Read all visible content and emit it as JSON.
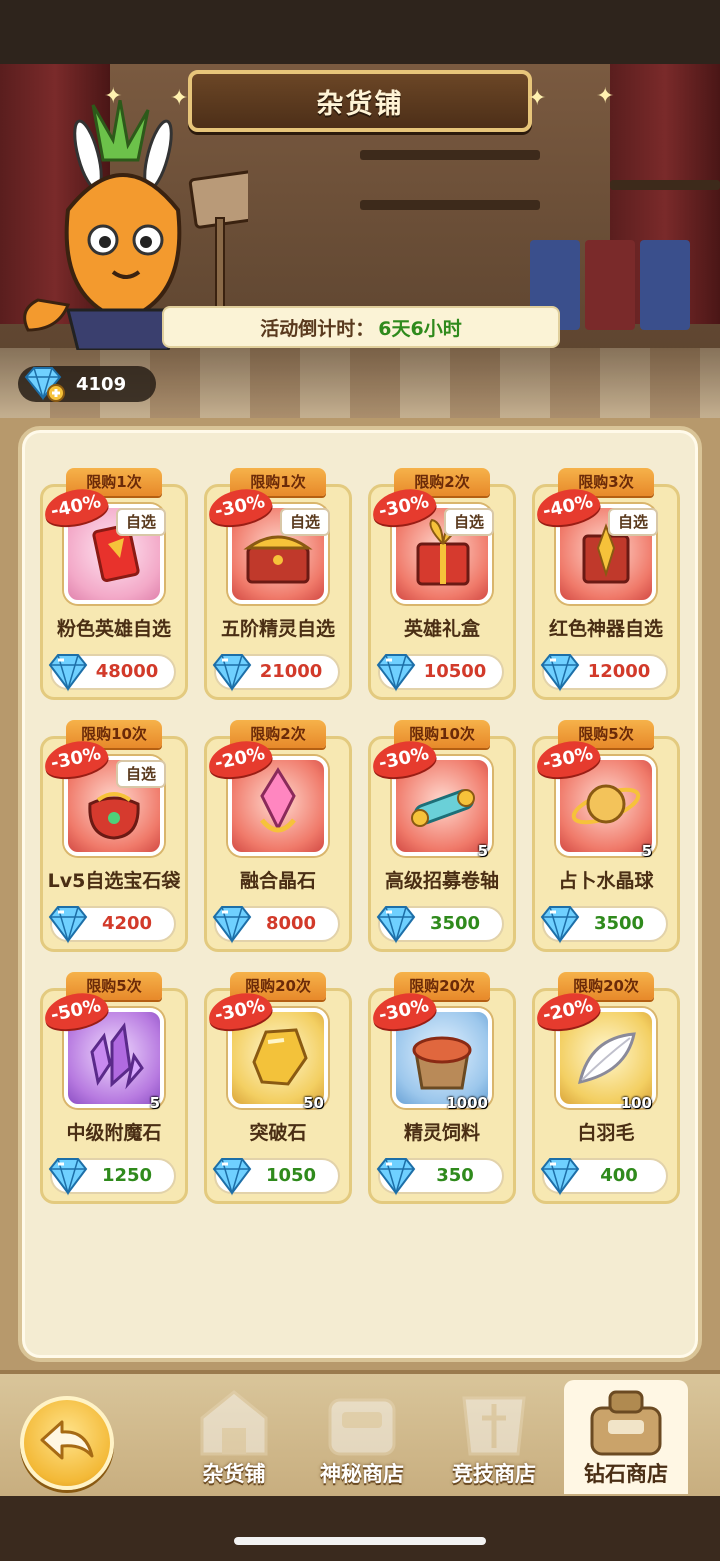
{
  "shop": {
    "title": "杂货铺",
    "countdown_label": "活动倒计时：",
    "countdown_value": "6天6小时",
    "currency_amount": "4109"
  },
  "items": [
    {
      "limit": "限购1次",
      "discount": "-40%",
      "choice": "自选",
      "name": "粉色英雄自选",
      "price": "48000",
      "price_color": "#d23a2a",
      "box": "pink",
      "icon": "pink-hero-card-icon"
    },
    {
      "limit": "限购1次",
      "discount": "-30%",
      "choice": "自选",
      "name": "五阶精灵自选",
      "price": "21000",
      "price_color": "#d23a2a",
      "box": "red",
      "icon": "treasure-chest-icon"
    },
    {
      "limit": "限购2次",
      "discount": "-30%",
      "choice": "自选",
      "name": "英雄礼盒",
      "price": "10500",
      "price_color": "#d23a2a",
      "box": "red",
      "icon": "hero-gift-box-icon"
    },
    {
      "limit": "限购3次",
      "discount": "-40%",
      "choice": "自选",
      "name": "红色神器自选",
      "price": "12000",
      "price_color": "#d23a2a",
      "box": "red",
      "icon": "red-artifact-icon"
    },
    {
      "limit": "限购10次",
      "discount": "-30%",
      "choice": "自选",
      "name": "Lv5自选宝石袋",
      "price": "4200",
      "price_color": "#d23a2a",
      "box": "red",
      "icon": "gem-pouch-icon"
    },
    {
      "limit": "限购2次",
      "discount": "-20%",
      "choice": "",
      "name": "融合晶石",
      "price": "8000",
      "price_color": "#d23a2a",
      "box": "red",
      "icon": "fusion-crystal-icon"
    },
    {
      "limit": "限购10次",
      "discount": "-30%",
      "choice": "",
      "qty": "5",
      "name": "高级招募卷轴",
      "price": "3500",
      "price_color": "#2f8a1c",
      "box": "red",
      "icon": "recruit-scroll-icon"
    },
    {
      "limit": "限购5次",
      "discount": "-30%",
      "choice": "",
      "qty": "5",
      "name": "占卜水晶球",
      "price": "3500",
      "price_color": "#2f8a1c",
      "box": "red",
      "icon": "crystal-ball-icon"
    },
    {
      "limit": "限购5次",
      "discount": "-50%",
      "choice": "",
      "qty": "5",
      "name": "中级附魔石",
      "price": "1250",
      "price_color": "#2f8a1c",
      "box": "purple",
      "icon": "enchant-stone-icon"
    },
    {
      "limit": "限购20次",
      "discount": "-30%",
      "choice": "",
      "qty": "50",
      "name": "突破石",
      "price": "1050",
      "price_color": "#2f8a1c",
      "box": "gold",
      "icon": "breakthrough-stone-icon"
    },
    {
      "limit": "限购20次",
      "discount": "-30%",
      "choice": "",
      "qty": "1000",
      "name": "精灵饲料",
      "price": "350",
      "price_color": "#2f8a1c",
      "box": "blue",
      "icon": "spirit-feed-icon"
    },
    {
      "limit": "限购20次",
      "discount": "-20%",
      "choice": "",
      "qty": "100",
      "name": "白羽毛",
      "price": "400",
      "price_color": "#2f8a1c",
      "box": "gold",
      "icon": "white-feather-icon"
    }
  ],
  "nav": {
    "tabs": [
      {
        "label": "杂货铺",
        "icon": "grocery-tent-icon",
        "active": false
      },
      {
        "label": "神秘商店",
        "icon": "mystery-shop-icon",
        "active": false
      },
      {
        "label": "竞技商店",
        "icon": "arena-shop-icon",
        "active": false
      },
      {
        "label": "钻石商店",
        "icon": "diamond-shop-icon",
        "active": true
      }
    ],
    "back_icon": "back-arrow-icon"
  },
  "colors": {
    "accent": "#e63b2e",
    "price_red": "#d23a2a",
    "price_green": "#2f8a1c",
    "limit_tag": "#f6b24a"
  }
}
